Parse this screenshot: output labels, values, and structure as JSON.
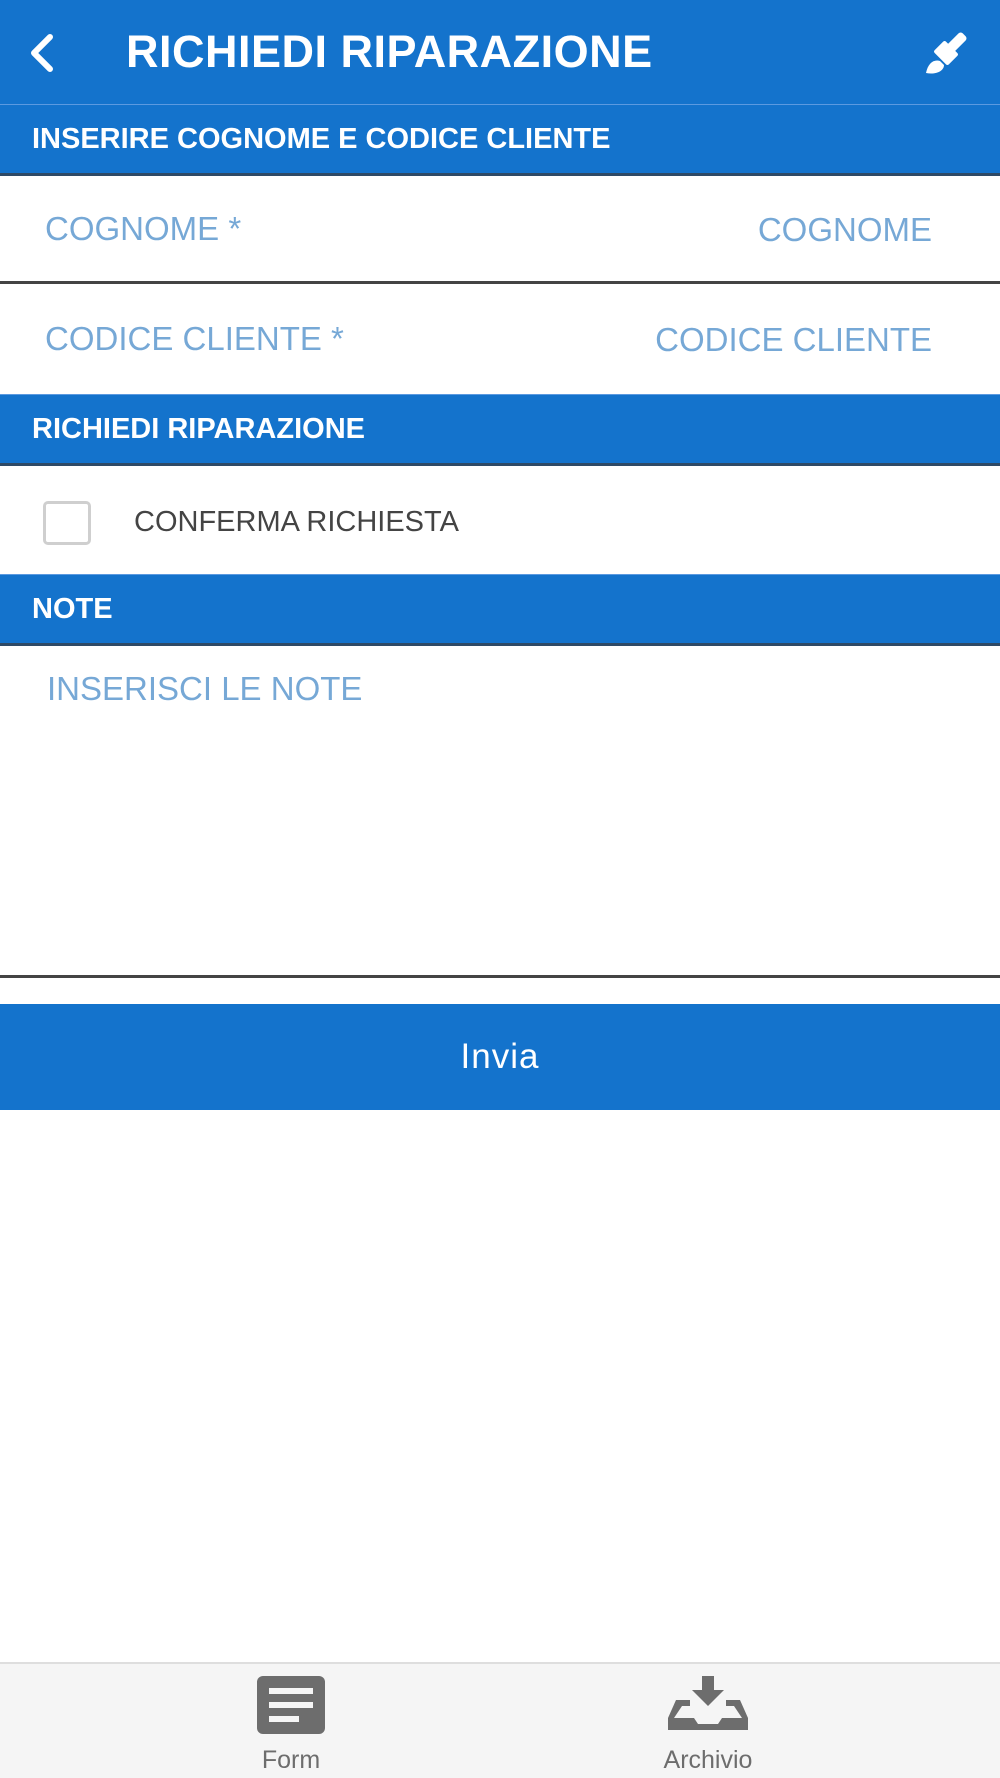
{
  "header": {
    "title": "RICHIEDI RIPARAZIONE",
    "back_icon": "chevron-left-icon",
    "action_icon": "paintbrush-icon"
  },
  "sections": {
    "customer": "INSERIRE COGNOME E CODICE CLIENTE",
    "repair": "RICHIEDI RIPARAZIONE",
    "notes": "NOTE"
  },
  "fields": {
    "surname": {
      "label": "COGNOME *",
      "placeholder": "COGNOME",
      "value": ""
    },
    "customer_code": {
      "label": "CODICE CLIENTE *",
      "placeholder": "CODICE CLIENTE",
      "value": ""
    }
  },
  "confirm": {
    "label": "CONFERMA RICHIESTA",
    "checked": false
  },
  "notes": {
    "placeholder": "INSERISCI LE NOTE",
    "value": ""
  },
  "submit_label": "Invia",
  "tabbar": {
    "items": [
      {
        "label": "Form",
        "icon": "form-document-icon"
      },
      {
        "label": "Archivio",
        "icon": "archive-download-icon"
      }
    ]
  },
  "colors": {
    "primary": "#1473cc",
    "placeholder": "#76a8d6",
    "tabbar_bg": "#f5f5f5",
    "icon_gray": "#6d6d6d"
  }
}
